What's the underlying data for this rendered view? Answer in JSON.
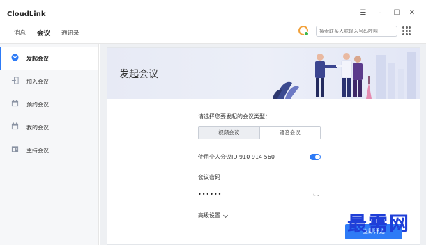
{
  "app": {
    "title": "CloudLink"
  },
  "nav": {
    "tabs": [
      {
        "label": "消息"
      },
      {
        "label": "会议"
      },
      {
        "label": "通讯录"
      }
    ]
  },
  "search": {
    "placeholder": "搜索联系人或输入号码呼叫"
  },
  "sidebar": {
    "items": [
      {
        "label": "发起会议",
        "icon": "start-meeting-icon"
      },
      {
        "label": "加入会议",
        "icon": "join-meeting-icon"
      },
      {
        "label": "预约会议",
        "icon": "calendar-icon"
      },
      {
        "label": "我的会议",
        "icon": "calendar-icon"
      },
      {
        "label": "主持会议",
        "icon": "host-icon"
      }
    ]
  },
  "main": {
    "banner_title": "发起会议",
    "type_prompt": "请选择您要发起的会议类型：",
    "type_options": [
      {
        "label": "视频会议"
      },
      {
        "label": "语音会议"
      }
    ],
    "personal_id_label": "使用个人会议ID 910 914 560",
    "password_label": "会议密码",
    "password_value": "••••••",
    "advanced_label": "高级设置",
    "start_button": "立即开始"
  },
  "watermark": "最需网",
  "colors": {
    "accent": "#2e7bf6",
    "watermark": "#1f3fd8"
  }
}
